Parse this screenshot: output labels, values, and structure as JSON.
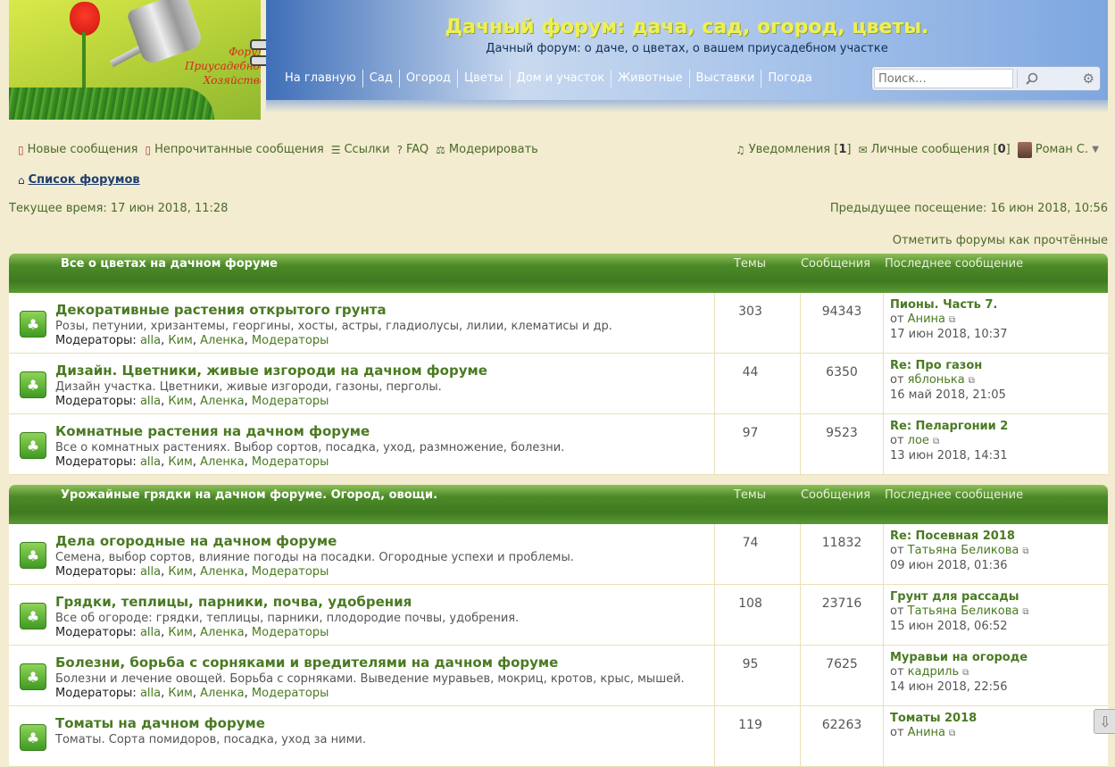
{
  "header": {
    "logo_tagline": [
      "Форум",
      "Приусадебное",
      "Хозяйство"
    ],
    "title": "Дачный форум: дача, сад, огород, цветы.",
    "description": "Дачный форум: о даче, о цветах, о вашем приусадебном участке",
    "nav": [
      "На главную",
      "Сад",
      "Огород",
      "Цветы",
      "Дом и участок",
      "Животные",
      "Выставки",
      "Погода"
    ],
    "search_placeholder": "Поиск...",
    "search_icon": "magnifier-icon",
    "advanced_icon": "gear-icon"
  },
  "userbar": {
    "new_posts": "Новые сообщения",
    "unread_posts": "Непрочитанные сообщения",
    "links": "Ссылки",
    "faq": "FAQ",
    "moderate": "Модерировать",
    "notifications_label": "Уведомления",
    "notifications_count": "1",
    "pm_label": "Личные сообщения",
    "pm_count": "0",
    "username": "Роман С."
  },
  "breadcrumb": {
    "home": "Список форумов"
  },
  "times": {
    "current": "Текущее время: 17 июн 2018, 11:28",
    "previous": "Предыдущее посещение: 16 июн 2018, 10:56"
  },
  "mark_read": "Отметить форумы как прочтённые",
  "columns": {
    "topics": "Темы",
    "posts": "Сообщения",
    "last_post": "Последнее сообщение"
  },
  "categories": [
    {
      "name": "Все о цветах на дачном форуме",
      "forums": [
        {
          "title": "Декоративные растения открытого грунта",
          "desc": "Розы, петунии, хризантемы, георгины, хосты, астры, гладиолусы, лилии, клематисы и др.",
          "topics": "303",
          "posts": "94343",
          "last_title": "Пионы. Часть 7.",
          "last_author": "Анина",
          "last_date": "17 июн 2018, 10:37"
        },
        {
          "title": "Дизайн. Цветники, живые изгороди на дачном форуме",
          "desc": "Дизайн участка. Цветники, живые изгороди, газоны, перголы.",
          "topics": "44",
          "posts": "6350",
          "last_title": "Re: Про газон",
          "last_author": "яблонька",
          "last_date": "16 май 2018, 21:05"
        },
        {
          "title": "Комнатные растения на дачном форуме",
          "desc": "Все о комнатных растениях. Выбор сортов, посадка, уход, размножение, болезни.",
          "topics": "97",
          "posts": "9523",
          "last_title": "Re: Пеларгонии 2",
          "last_author": "лое",
          "last_date": "13 июн 2018, 14:31"
        }
      ]
    },
    {
      "name": "Урожайные грядки на дачном форуме. Огород, овощи.",
      "forums": [
        {
          "title": "Дела огородные на дачном форуме",
          "desc": "Семена, выбор сортов, влияние погоды на посадки. Огородные успехи и проблемы.",
          "topics": "74",
          "posts": "11832",
          "last_title": "Re: Посевная 2018",
          "last_author": "Татьяна Беликова",
          "last_date": "09 июн 2018, 01:36"
        },
        {
          "title": "Грядки, теплицы, парники, почва, удобрения",
          "desc": "Все об огороде: грядки, теплицы, парники, плодородие почвы, удобрения.",
          "topics": "108",
          "posts": "23716",
          "last_title": "Грунт для рассады",
          "last_author": "Татьяна Беликова",
          "last_date": "15 июн 2018, 06:52"
        },
        {
          "title": "Болезни, борьба с сорняками и вредителями на дачном форуме",
          "desc": "Болезни и лечение овощей. Борьба с сорняками. Выведение муравьев, мокриц, кротов, крыс, мышей.",
          "topics": "95",
          "posts": "7625",
          "last_title": "Муравьи на огороде",
          "last_author": "кадриль",
          "last_date": "14 июн 2018, 22:56"
        },
        {
          "title": "Томаты на дачном форуме",
          "desc": "Томаты. Сорта помидоров, посадка, уход за ними.",
          "topics": "119",
          "posts": "62263",
          "last_title": "Томаты 2018",
          "last_author": "Анина",
          "last_date": ""
        }
      ]
    }
  ],
  "moderators": {
    "label": "Модераторы:",
    "list": [
      "alla",
      "Ким",
      "Аленка",
      "Модераторы"
    ]
  },
  "last_post_by": "от"
}
